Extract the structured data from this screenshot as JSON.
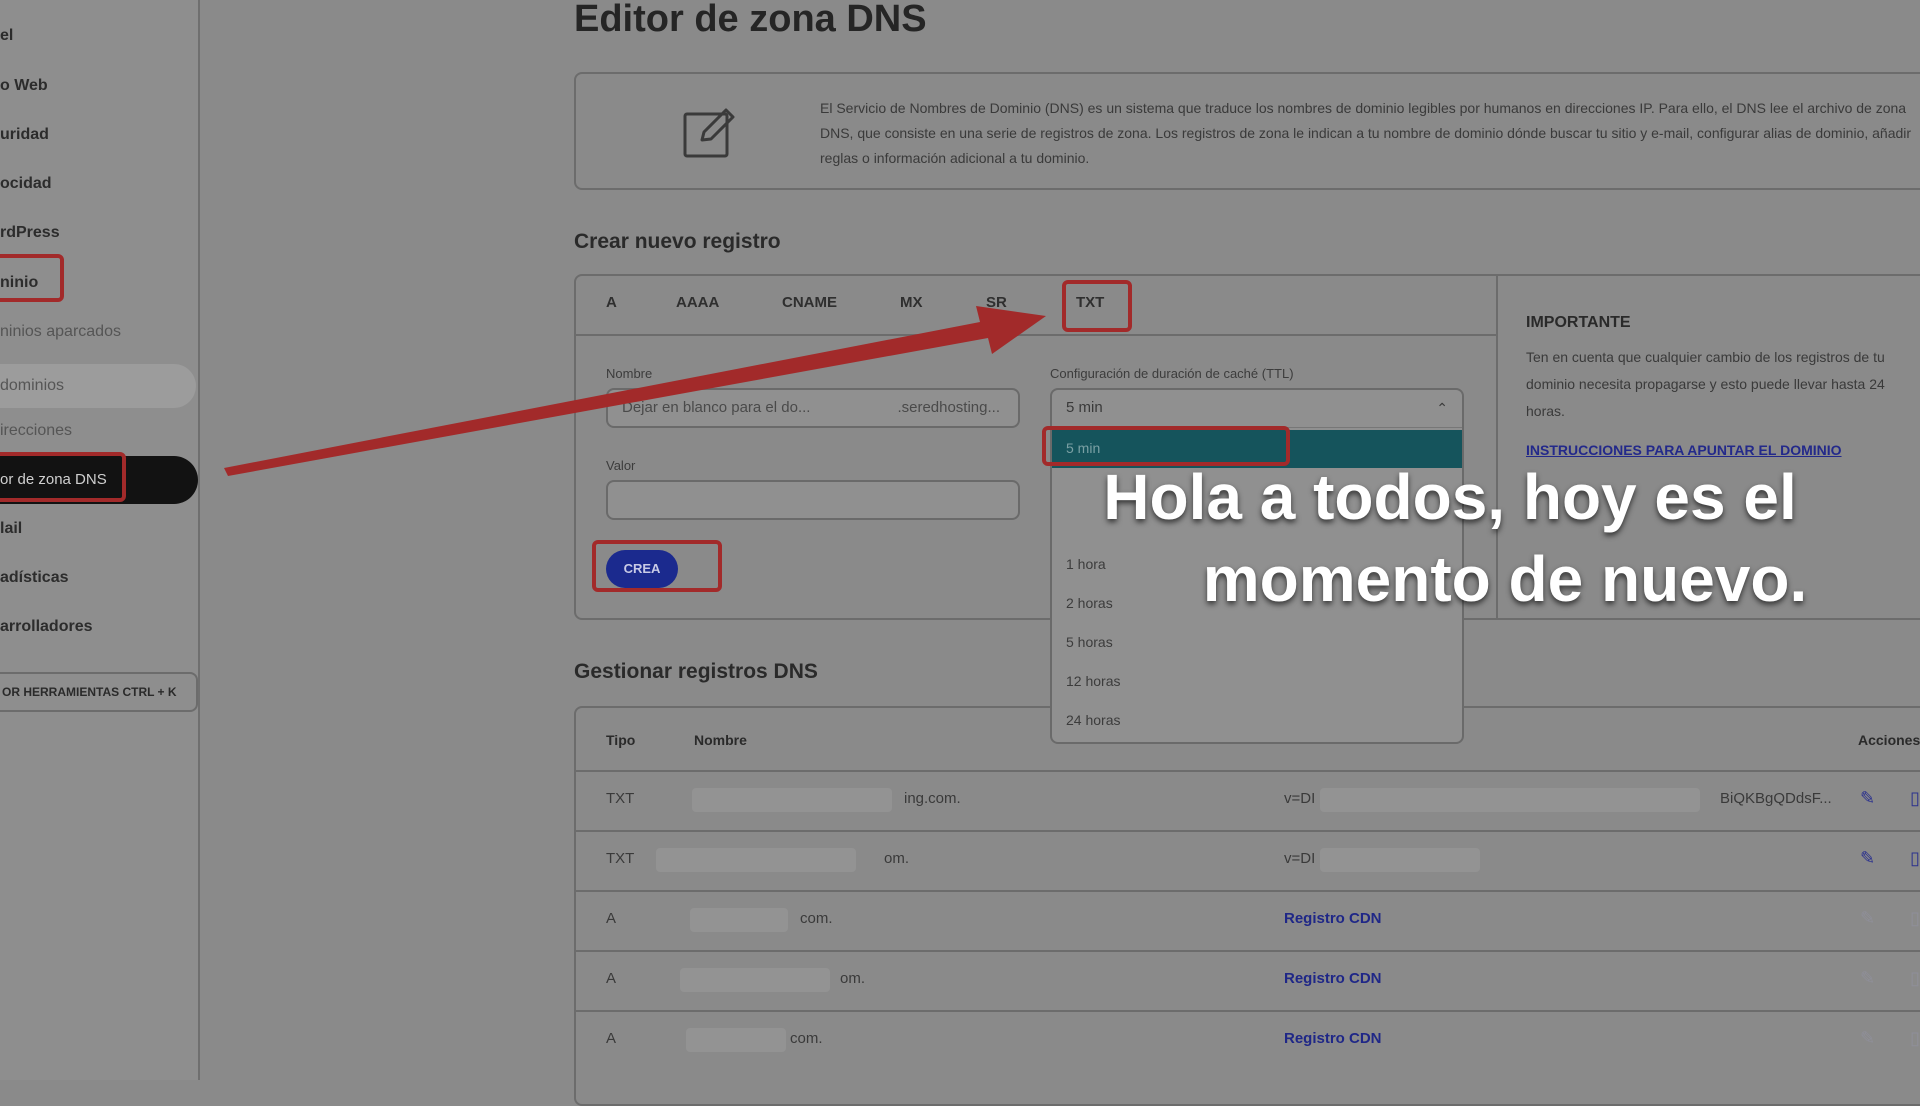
{
  "sidebar": {
    "items": [
      {
        "label": "el"
      },
      {
        "label": "o Web"
      },
      {
        "label": "uridad"
      },
      {
        "label": "ocidad"
      },
      {
        "label": "rdPress"
      },
      {
        "label": "ninio"
      },
      {
        "label": "ninios aparcados"
      },
      {
        "label": "dominios"
      },
      {
        "label": "irecciones"
      },
      {
        "label": "or de zona DNS"
      },
      {
        "label": "lail"
      },
      {
        "label": "adísticas"
      },
      {
        "label": "arrolladores"
      }
    ],
    "tools_shortcut": "OR HERRAMIENTAS CTRL + K"
  },
  "page": {
    "title": "Editor de zona DNS",
    "info": "El Servicio de Nombres de Dominio (DNS) es un sistema que traduce los nombres de dominio legibles por humanos en direcciones IP. Para ello, el DNS lee el archivo de zona DNS, que consiste en una serie de registros de zona. Los registros de zona le indican a tu nombre de dominio dónde buscar tu sitio y e-mail, configurar alias de dominio, añadir reglas o información adicional a tu dominio."
  },
  "create": {
    "title": "Crear nuevo registro",
    "tabs": [
      "A",
      "AAAA",
      "CNAME",
      "MX",
      "SR",
      "TXT"
    ],
    "name_label": "Nombre",
    "name_placeholder": "Dejar en blanco para el do...",
    "name_suffix": ".seredhosting...",
    "value_label": "Valor",
    "ttl_label": "Configuración de duración de caché (TTL)",
    "ttl_value": "5 min",
    "button": "CREA",
    "important_title": "IMPORTANTE",
    "important_text": "Ten en cuenta que cualquier cambio de los registros de tu dominio necesita propagarse y esto puede llevar hasta 24 horas.",
    "important_link": "INSTRUCCIONES PARA APUNTAR EL DOMINIO"
  },
  "ttl_dropdown": {
    "selected": "5 min",
    "options": [
      "1 hora",
      "2 horas",
      "5 horas",
      "12 horas",
      "24 horas"
    ]
  },
  "manage": {
    "title": "Gestionar registros DNS",
    "headers": {
      "type": "Tipo",
      "name": "Nombre",
      "actions": "Acciones"
    },
    "rows": [
      {
        "type": "TXT",
        "name": "ing.com.",
        "value": "v=DI",
        "extra": "BiQKBgQDdsF..."
      },
      {
        "type": "TXT",
        "name": "om.",
        "value": "v=DI",
        "extra": ""
      },
      {
        "type": "A",
        "name": "com.",
        "value": "Registro CDN",
        "extra": ""
      },
      {
        "type": "A",
        "name": "om.",
        "value": "Registro CDN",
        "extra": ""
      },
      {
        "type": "A",
        "name": "com.",
        "value": "Registro CDN",
        "extra": ""
      }
    ]
  },
  "caption": {
    "line1": "Hola a todos, hoy es el",
    "line2": "momento de nuevo."
  },
  "colors": {
    "annotation_red": "#a22a2a",
    "button_blue": "#1b2a8e",
    "selected_teal": "#15545c",
    "link_blue": "#23298a"
  }
}
